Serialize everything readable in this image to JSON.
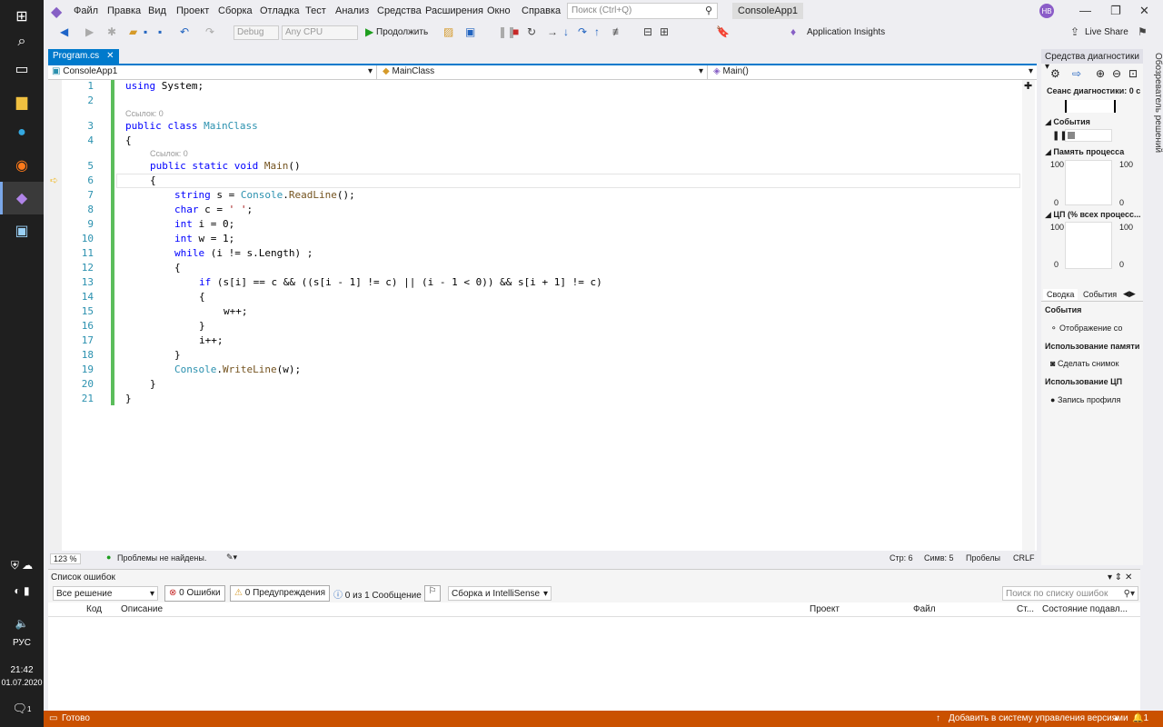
{
  "taskbar": {
    "lang": "РУС",
    "time": "21:42",
    "date": "01.07.2020",
    "notif": "1"
  },
  "menu": {
    "items": [
      "Файл",
      "Правка",
      "Вид",
      "Проект",
      "Сборка",
      "Отладка",
      "Тест",
      "Анализ",
      "Средства",
      "Расширения",
      "Окно",
      "Справка"
    ],
    "search_placeholder": "Поиск (Ctrl+Q)",
    "solution_name": "ConsoleApp1",
    "avatar_initials": "НВ"
  },
  "toolbar": {
    "config": "Debug",
    "platform": "Any CPU",
    "continue_label": "Продолжить",
    "app_insights": "Application Insights",
    "live_share": "Live Share"
  },
  "tabs": {
    "active_tab": "Program.cs",
    "close_glyph": "✕"
  },
  "navbar": {
    "project": "ConsoleApp1",
    "class": "MainClass",
    "member": "Main()"
  },
  "editor": {
    "line_numbers": [
      "1",
      "2",
      "3",
      "4",
      "5",
      "6",
      "7",
      "8",
      "9",
      "10",
      "11",
      "12",
      "13",
      "14",
      "15",
      "16",
      "17",
      "18",
      "19",
      "20",
      "21"
    ],
    "codelens_class": "Ссылок: 0",
    "codelens_method": "Ссылок: 0"
  },
  "editor_status": {
    "zoom": "123 %",
    "issues": "Проблемы не найдены.",
    "line": "Стр: 6",
    "col": "Симв: 5",
    "spaces": "Пробелы",
    "eol": "CRLF"
  },
  "diagnostics": {
    "title": "Средства диагностики",
    "session": "Сеанс диагностики: 0 с",
    "events": "События",
    "memory": "Память процесса",
    "cpu": "ЦП (% всех процесс...",
    "mem_max": "100",
    "mem_min": "0",
    "cpu_max": "100",
    "cpu_min": "0",
    "tab_summary": "Сводка",
    "tab_events": "События",
    "sec_events": "События",
    "show_events": "Отображение со",
    "sec_memory": "Использование памяти",
    "snapshot": "Сделать снимок",
    "sec_cpu": "Использование ЦП",
    "record_profile": "Запись профиля"
  },
  "side_tab": "Обозреватель решений",
  "errors": {
    "title": "Список ошибок",
    "scope": "Все решение",
    "errors_btn": "0 Ошибки",
    "warnings_btn": "0 Предупреждения",
    "messages_btn": "0 из 1 Сообщение",
    "build_filter": "Сборка и IntelliSense",
    "search_placeholder": "Поиск по списку ошибок",
    "col_code": "Код",
    "col_desc": "Описание",
    "col_project": "Проект",
    "col_file": "Файл",
    "col_line": "Ст...",
    "col_state": "Состояние подавл..."
  },
  "status": {
    "ready": "Готово",
    "vcs": "Добавить в систему управления версиями",
    "badge": "1"
  }
}
